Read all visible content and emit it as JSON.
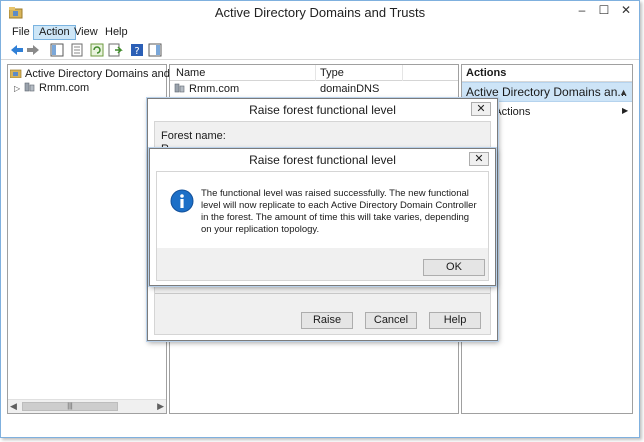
{
  "window": {
    "title": "Active Directory Domains and Trusts",
    "controls": {
      "minimize": "–",
      "maximize": "☐",
      "close": "✕"
    }
  },
  "menu": {
    "items": [
      "File",
      "Action",
      "View",
      "Help"
    ],
    "active": "Action"
  },
  "toolbar": {
    "icons": [
      "back-icon",
      "forward-icon",
      "console-tree-icon",
      "properties-icon",
      "refresh-icon",
      "export-list-icon",
      "help-icon",
      "show-hide-action-pane-icon"
    ]
  },
  "tree": {
    "root": "Active Directory Domains and Trust",
    "child": "Rmm.com"
  },
  "list": {
    "columns": [
      "Name",
      "Type"
    ],
    "rows": [
      {
        "name": "Rmm.com",
        "type": "domainDNS"
      }
    ]
  },
  "actions": {
    "header": "Actions",
    "group": "Active Directory Domains an...",
    "item": "ore Actions"
  },
  "dialog_back": {
    "title": "Raise forest functional level",
    "forest_label": "Forest name:",
    "forest_value": "R",
    "buttons": {
      "raise": "Raise",
      "cancel": "Cancel",
      "help": "Help"
    }
  },
  "dialog_front": {
    "title": "Raise forest functional level",
    "message": "The functional level was raised successfully. The new functional level will now replicate to each Active Directory Domain Controller in the forest. The amount of time this will take varies, depending on your replication topology.",
    "ok": "OK"
  },
  "colors": {
    "selection": "#cde4f7",
    "info_icon": "#1c6fc7",
    "window_border": "#7fb0de"
  }
}
